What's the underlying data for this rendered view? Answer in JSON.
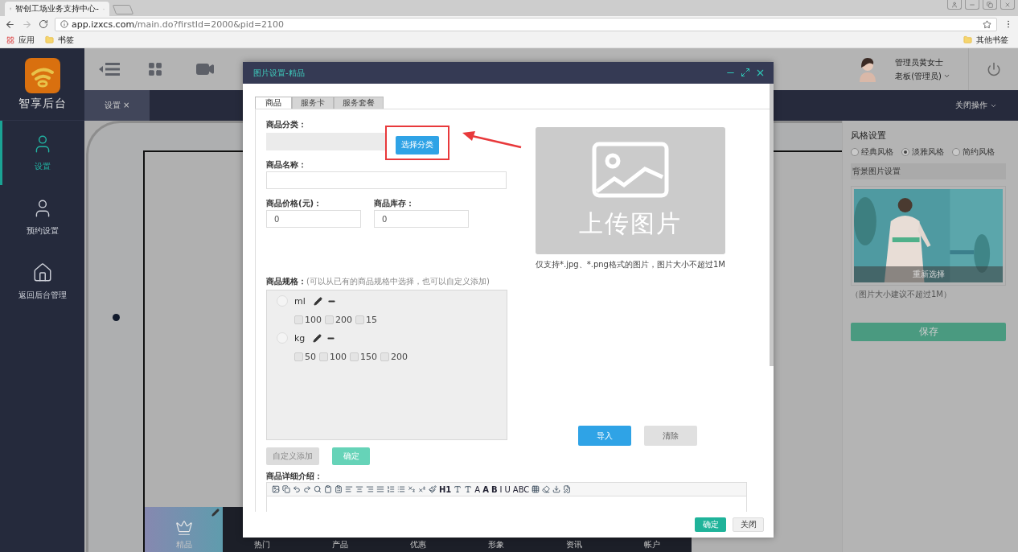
{
  "browser": {
    "tab_title": "智创工场业务支持中心-",
    "url_host": "app.izxcs.com",
    "url_path": "/main.do?firstId=2000&pid=2100",
    "bookmarks": [
      "应用",
      "书签"
    ],
    "other_bookmarks": "其他书签"
  },
  "sidebar": {
    "brand": "智享后台",
    "items": [
      {
        "label": "设置",
        "selected": true
      },
      {
        "label": "预约设置",
        "selected": false
      },
      {
        "label": "返回后台管理",
        "selected": false
      }
    ]
  },
  "header": {
    "user_name": "管理员黄女士",
    "user_role": "老板(管理员)"
  },
  "tabs": [
    {
      "label": "设置",
      "close": "×",
      "selected": true
    }
  ],
  "close_all": "关闭操作",
  "preview": {
    "nav": [
      {
        "label": "精品",
        "selected": true
      },
      {
        "label": "热门",
        "selected": false
      },
      {
        "label": "产品",
        "selected": false
      },
      {
        "label": "优惠",
        "selected": false
      },
      {
        "label": "形象",
        "selected": false
      },
      {
        "label": "资讯",
        "selected": false
      },
      {
        "label": "帐户",
        "selected": false
      }
    ]
  },
  "style_panel": {
    "title": "风格设置",
    "styles": [
      {
        "label": "经典风格",
        "selected": false
      },
      {
        "label": "淡雅风格",
        "selected": true
      },
      {
        "label": "简约风格",
        "selected": false
      }
    ],
    "background_title": "背景图片设置",
    "reselect": "重新选择",
    "size_hint": "（图片大小建议不超过1M）",
    "save": "保存"
  },
  "dialog": {
    "title": "图片设置-精品",
    "tabs": [
      {
        "label": "商品",
        "selected": true
      },
      {
        "label": "服务卡",
        "selected": false
      },
      {
        "label": "服务套餐",
        "selected": false
      }
    ],
    "category": {
      "label": "商品分类：",
      "disabled": true,
      "button": "选择分类"
    },
    "name": {
      "label": "商品名称："
    },
    "price": {
      "label": "商品价格(元)：",
      "value": "0"
    },
    "stock": {
      "label": "商品库存：",
      "value": "0"
    },
    "spec": {
      "label": "商品规格：",
      "hint": "(可以从已有的商品规格中选择，也可以自定义添加)",
      "groups": [
        {
          "name": "ml",
          "selected": false,
          "options": [
            {
              "label": "100",
              "checked": false
            },
            {
              "label": "200",
              "checked": false
            },
            {
              "label": "15",
              "checked": false
            }
          ]
        },
        {
          "name": "kg",
          "selected": false,
          "options": [
            {
              "label": "50",
              "checked": false
            },
            {
              "label": "100",
              "checked": false
            },
            {
              "label": "150",
              "checked": false
            },
            {
              "label": "200",
              "checked": false
            }
          ]
        }
      ]
    },
    "custom_add": {
      "label": "自定义添加",
      "disabled": true
    },
    "spec_confirm": {
      "label": "确定",
      "disabled": true
    },
    "editor": {
      "label": "商品详细介绍：",
      "toolbar_text": [
        "H1",
        "A",
        "A",
        "B",
        "I",
        "U",
        "ABC"
      ]
    },
    "upload": {
      "label": "上传图片",
      "caption": "仅支持*.jpg、*.png格式的图片，图片大小不超过1M"
    },
    "import": {
      "label": "导入",
      "disabled": false
    },
    "clear": {
      "label": "清除",
      "disabled": true
    },
    "confirm": "确定",
    "close": "关闭"
  }
}
